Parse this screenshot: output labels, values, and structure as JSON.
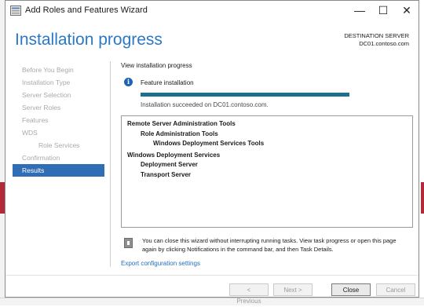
{
  "window": {
    "title": "Add Roles and Features Wizard"
  },
  "window_controls": {
    "minimize": "—",
    "maximize": "☐",
    "close": "✕"
  },
  "header": {
    "title": "Installation progress",
    "destination_label": "DESTINATION SERVER",
    "destination_server": "DC01.contoso.com"
  },
  "sidebar": {
    "items": [
      {
        "label": "Before You Begin",
        "level": 0,
        "active": false
      },
      {
        "label": "Installation Type",
        "level": 0,
        "active": false
      },
      {
        "label": "Server Selection",
        "level": 0,
        "active": false
      },
      {
        "label": "Server Roles",
        "level": 0,
        "active": false
      },
      {
        "label": "Features",
        "level": 0,
        "active": false
      },
      {
        "label": "WDS",
        "level": 0,
        "active": false
      },
      {
        "label": "Role Services",
        "level": 1,
        "active": false
      },
      {
        "label": "Confirmation",
        "level": 0,
        "active": false
      },
      {
        "label": "Results",
        "level": 0,
        "active": true
      }
    ]
  },
  "main": {
    "heading": "View installation progress",
    "feature_label": "Feature installation",
    "progress_fraction": 1.0,
    "status": "Installation succeeded on DC01.contoso.com.",
    "results": [
      {
        "text": "Remote Server Administration Tools",
        "level": 0
      },
      {
        "text": "Role Administration Tools",
        "level": 1
      },
      {
        "text": "Windows Deployment Services Tools",
        "level": 2
      },
      {
        "text": "Windows Deployment Services",
        "level": 0
      },
      {
        "text": "Deployment Server",
        "level": 1
      },
      {
        "text": "Transport Server",
        "level": 1
      }
    ],
    "note": "You can close this wizard without interrupting running tasks. View task progress or open this page again by clicking Notifications in the command bar, and then Task Details.",
    "export_link": "Export configuration settings"
  },
  "buttons": {
    "previous": "< Previous",
    "next": "Next >",
    "close": "Close",
    "cancel": "Cancel"
  },
  "colors": {
    "accent": "#2a78c6",
    "nav_active": "#2f6db5",
    "progress": "#1c7389"
  }
}
